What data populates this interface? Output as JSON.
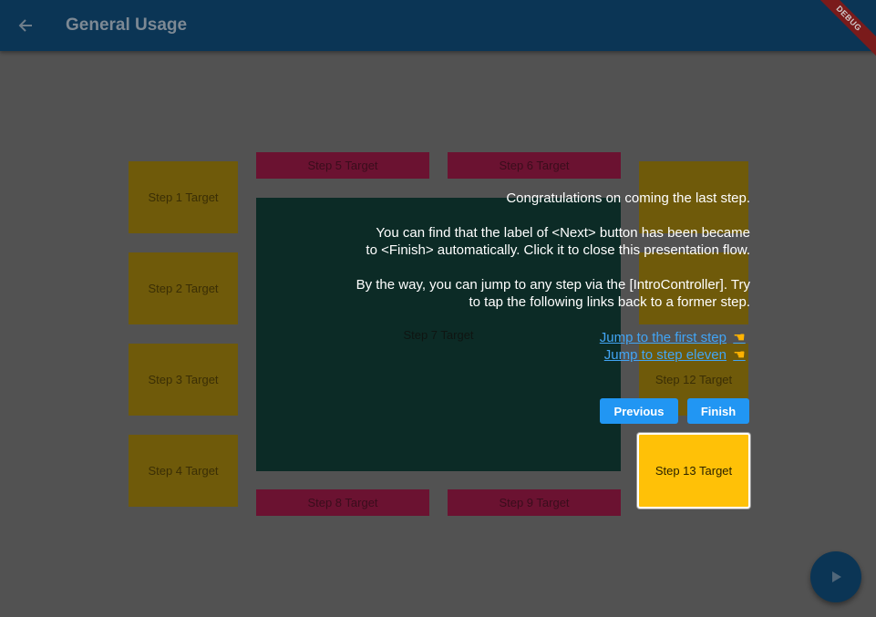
{
  "appbar": {
    "title": "General Usage",
    "debug_label": "DEBUG"
  },
  "targets": {
    "step1": "Step 1 Target",
    "step2": "Step 2 Target",
    "step3": "Step 3 Target",
    "step4": "Step 4 Target",
    "step5": "Step 5 Target",
    "step6": "Step 6 Target",
    "step7": "Step 7 Target",
    "step8": "Step 8 Target",
    "step9": "Step 9 Target",
    "step12": "Step 12 Target",
    "step13": "Step 13 Target"
  },
  "tooltip": {
    "line1": "Congratulations on coming the last step.",
    "line2": "You can find that the label of <Next> button has been became",
    "line3": "to  <Finish> automatically. Click it to close this presentation flow.",
    "line4": "By the way, you can jump to any step via the [IntroController]. Try",
    "line5": "to tap the following links back to a former step.",
    "link_first": "Jump to the first step",
    "link_eleven": "Jump to step eleven",
    "previous_label": "Previous",
    "finish_label": "Finish"
  },
  "icons": {
    "back": "arrow-back-icon",
    "play": "play-icon",
    "hand": "pointing-hand-icon"
  },
  "colors": {
    "accent": "#2196f3",
    "highlight": "#ffc107",
    "appbar": "#0b3555",
    "link": "#42a5f5"
  }
}
